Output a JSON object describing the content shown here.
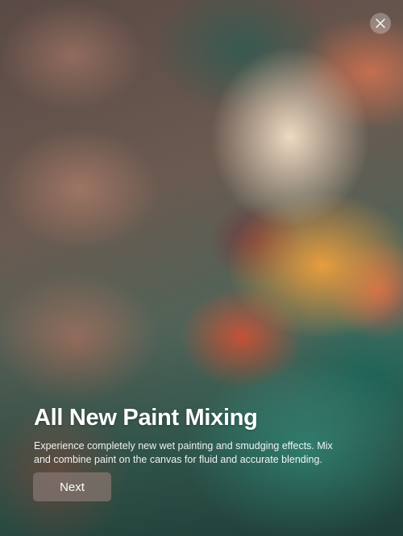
{
  "dialog": {
    "close_icon": "close-icon",
    "title": "All New Paint Mixing",
    "description": "Experience completely new wet painting and smudging effects. Mix and combine paint on the canvas for fluid and accurate blending.",
    "next_label": "Next"
  },
  "colors": {
    "title_text": "#ffffff",
    "button_bg": "rgba(130,115,110,0.78)",
    "close_bg": "rgba(255,255,255,0.28)"
  }
}
